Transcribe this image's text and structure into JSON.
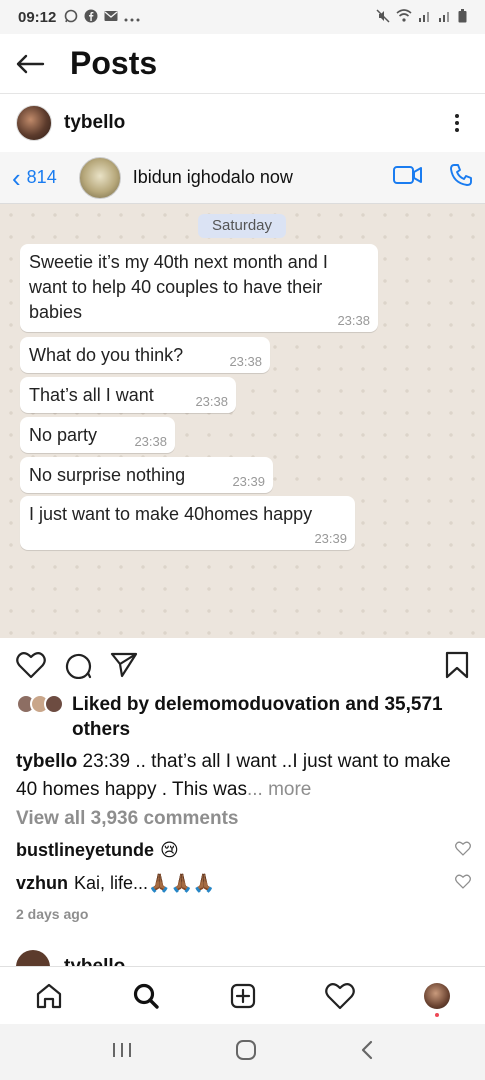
{
  "status_bar": {
    "time": "09:12",
    "left_icons": [
      "whatsapp-icon",
      "facebook-icon",
      "email-icon",
      "more-icon"
    ],
    "right_icons": [
      "mute-icon",
      "wifi-icon",
      "signal-icon",
      "signal-icon",
      "battery-icon"
    ]
  },
  "header": {
    "title": "Posts"
  },
  "post": {
    "author": "tybello",
    "image": {
      "chat_header": {
        "back_count": "814",
        "contact": "Ibidun ighodalo now"
      },
      "date_label": "Saturday",
      "messages": [
        {
          "text": "Sweetie it’s my 40th next month and I want to help 40 couples to have their babies",
          "time": "23:38"
        },
        {
          "text": "What do you think?",
          "time": "23:38"
        },
        {
          "text": "That’s all I want",
          "time": "23:38"
        },
        {
          "text": "No party",
          "time": "23:38"
        },
        {
          "text": "No surprise nothing",
          "time": "23:39"
        },
        {
          "text": "I just want to make 40homes happy",
          "time": "23:39"
        }
      ]
    },
    "likes_text": "Liked by delemomoduovation and 35,571 others",
    "caption": {
      "user": "tybello",
      "text": " 23:39 .. that’s all I want ..I just want to make 40 homes happy . This was",
      "more": "... more"
    },
    "view_comments": "View all 3,936 comments",
    "comments": [
      {
        "user": "bustlineyetunde",
        "text": "😢"
      },
      {
        "user": "vzhun",
        "text": "Kai, life...🙏🏾🙏🏾🙏🏾"
      }
    ],
    "time_ago": "2 days ago"
  },
  "next_post": {
    "author": "tybello"
  },
  "colors": {
    "whatsapp_blue": "#1a7cf0",
    "chat_bg": "#ece5dd",
    "muted": "#8e8e8e",
    "notification": "#ed4956"
  }
}
